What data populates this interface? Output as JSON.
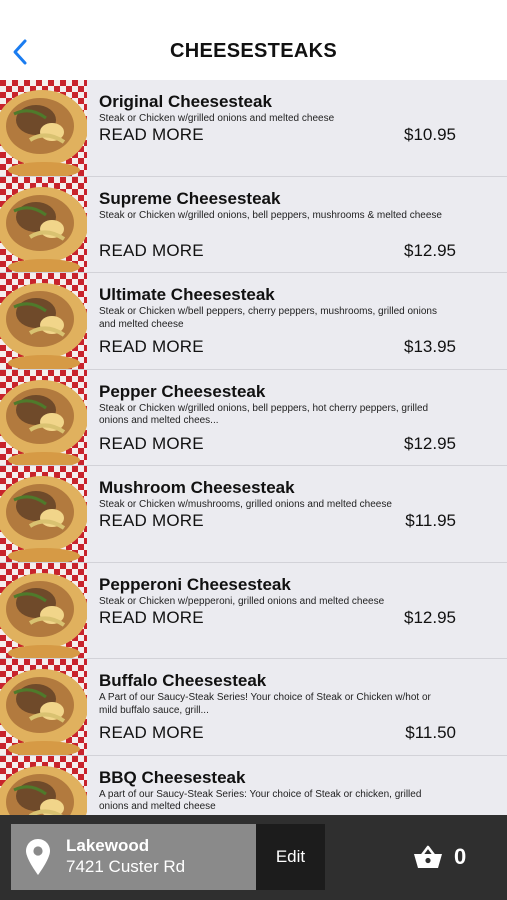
{
  "nav": {
    "title": "CHEESESTEAKS",
    "back_icon": "chevron-left-icon",
    "accent_color": "#1a7cf0"
  },
  "menu": {
    "read_more_label": "READ MORE",
    "items": [
      {
        "name": "Original Cheesesteak",
        "description": "Steak or Chicken w/grilled onions and melted cheese",
        "price": "$10.95"
      },
      {
        "name": "Supreme Cheesesteak",
        "description": "Steak or Chicken w/grilled onions, bell peppers, mushrooms & melted cheese",
        "price": "$12.95"
      },
      {
        "name": "Ultimate Cheesesteak",
        "description": "Steak or Chicken w/bell peppers, cherry peppers, mushrooms, grilled onions and melted cheese",
        "price": "$13.95"
      },
      {
        "name": "Pepper Cheesesteak",
        "description": "Steak or Chicken w/grilled onions, bell peppers, hot cherry peppers, grilled onions and melted chees...",
        "price": "$12.95"
      },
      {
        "name": "Mushroom Cheesesteak",
        "description": "Steak or Chicken w/mushrooms, grilled onions and melted cheese",
        "price": "$11.95"
      },
      {
        "name": "Pepperoni Cheesesteak",
        "description": "Steak or Chicken w/pepperoni, grilled onions and melted cheese",
        "price": "$12.95"
      },
      {
        "name": "Buffalo Cheesesteak",
        "description": "A Part of our Saucy-Steak Series! Your choice of Steak or Chicken w/hot or mild buffalo sauce, grill...",
        "price": "$11.50"
      },
      {
        "name": "BBQ Cheesesteak",
        "description": "A part of our Saucy-Steak Series: Your choice of Steak or chicken, grilled onions and melted cheese",
        "price": ""
      }
    ]
  },
  "footer": {
    "location_name": "Lakewood",
    "location_address": "7421 Custer Rd",
    "edit_label": "Edit",
    "cart_count": "0",
    "pin_icon": "map-pin-icon",
    "cart_icon": "basket-icon"
  }
}
